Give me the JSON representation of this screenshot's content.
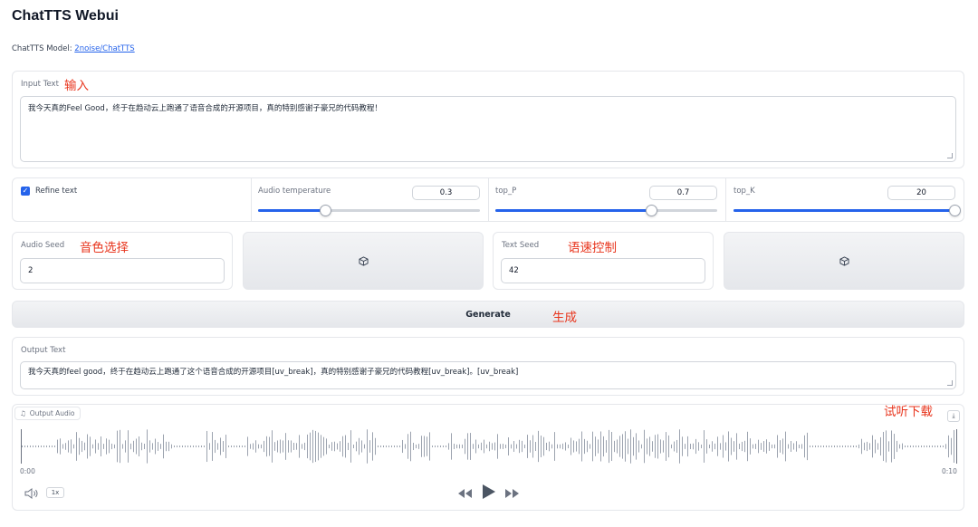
{
  "app": {
    "title": "ChatTTS Webui",
    "model_prefix": "ChatTTS Model: ",
    "model_link": "2noise/ChatTTS"
  },
  "annotations": {
    "input": "输入",
    "voice": "音色选择",
    "speed": "语速控制",
    "generate": "生成",
    "download": "试听下载"
  },
  "input": {
    "label": "Input Text",
    "value": "我今天真的Feel Good，终于在趋动云上跑通了语音合成的开源项目，真的特别感谢子豪兄的代码教程！"
  },
  "controls": {
    "refine_text": {
      "label": "Refine text",
      "checked": true
    },
    "audio_temperature": {
      "label": "Audio temperature",
      "value": "0.3",
      "fraction": 0.3
    },
    "top_p": {
      "label": "top_P",
      "value": "0.7",
      "fraction": 0.7
    },
    "top_k": {
      "label": "top_K",
      "value": "20",
      "fraction": 1.0
    }
  },
  "seeds": {
    "audio_seed": {
      "label": "Audio Seed",
      "value": "2"
    },
    "text_seed": {
      "label": "Text Seed",
      "value": "42"
    },
    "dice_icon": "dice-icon"
  },
  "generate_label": "Generate",
  "output": {
    "label": "Output Text",
    "value": "我今天真的feel good，终于在趋动云上跑通了这个语音合成的开源项目[uv_break]，真的特别感谢子豪兄的代码教程[uv_break]。[uv_break]"
  },
  "audio": {
    "label": "Output Audio",
    "time_start": "0:00",
    "time_end": "0:10",
    "speed": "1x",
    "icons": [
      "music-note-icon",
      "download-icon",
      "volume-icon",
      "rewind-icon",
      "play-icon",
      "fast-forward-icon"
    ]
  },
  "colors": {
    "accent": "#2563eb",
    "annotation": "#e8351d"
  }
}
